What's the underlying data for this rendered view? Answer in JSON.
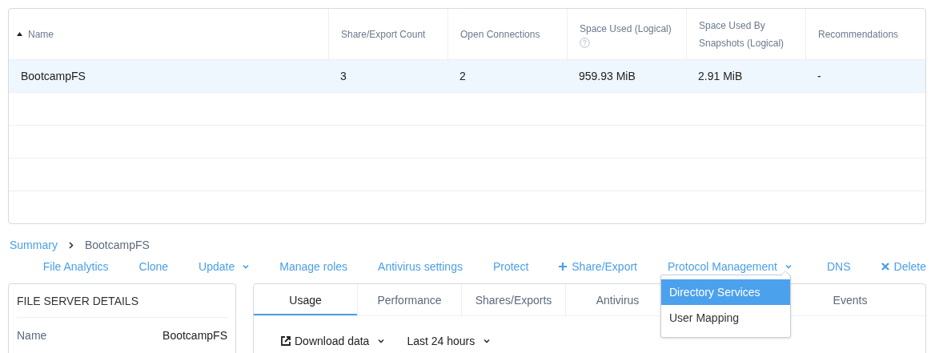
{
  "table": {
    "columns": [
      {
        "label": "Name",
        "sort_ascending": true
      },
      {
        "label": "Share/Export Count"
      },
      {
        "label": "Open Connections"
      },
      {
        "label": "Space Used (Logical)",
        "help": true
      },
      {
        "label": "Space Used By Snapshots (Logical)"
      },
      {
        "label": "Recommendations"
      }
    ],
    "rows": [
      {
        "cells": [
          "BootcampFS",
          "3",
          "2",
          "959.93 MiB",
          "2.91 MiB",
          "-"
        ],
        "selected": true
      }
    ]
  },
  "breadcrumb": {
    "link": "Summary",
    "current": "BootcampFS"
  },
  "actions": [
    {
      "label": "File Analytics",
      "kind": "plain"
    },
    {
      "label": "Clone",
      "kind": "plain"
    },
    {
      "label": "Update",
      "kind": "dropdown"
    },
    {
      "label": "Manage roles",
      "kind": "plain"
    },
    {
      "label": "Antivirus settings",
      "kind": "plain"
    },
    {
      "label": "Protect",
      "kind": "plain"
    },
    {
      "label": "Share/Export",
      "kind": "add"
    },
    {
      "label": "Protocol Management",
      "kind": "dropdown",
      "expanded": true
    },
    {
      "label": "DNS",
      "kind": "plain"
    },
    {
      "label": "Delete",
      "kind": "delete"
    }
  ],
  "menu": {
    "items": [
      {
        "label": "Directory Services",
        "selected": true
      },
      {
        "label": "User Mapping",
        "selected": false
      }
    ]
  },
  "details": {
    "title": "FILE SERVER DETAILS",
    "fields": [
      {
        "label": "Name",
        "value": "BootcampFS"
      }
    ]
  },
  "tabs": [
    {
      "label": "Usage",
      "selected": true
    },
    {
      "label": "Performance",
      "selected": false
    },
    {
      "label": "Shares/Exports",
      "selected": false
    },
    {
      "label": "Antivirus",
      "selected": false
    },
    {
      "label": "Events",
      "selected": false
    }
  ],
  "toolbar": {
    "download": "Download data",
    "range": "Last 24 hours"
  }
}
